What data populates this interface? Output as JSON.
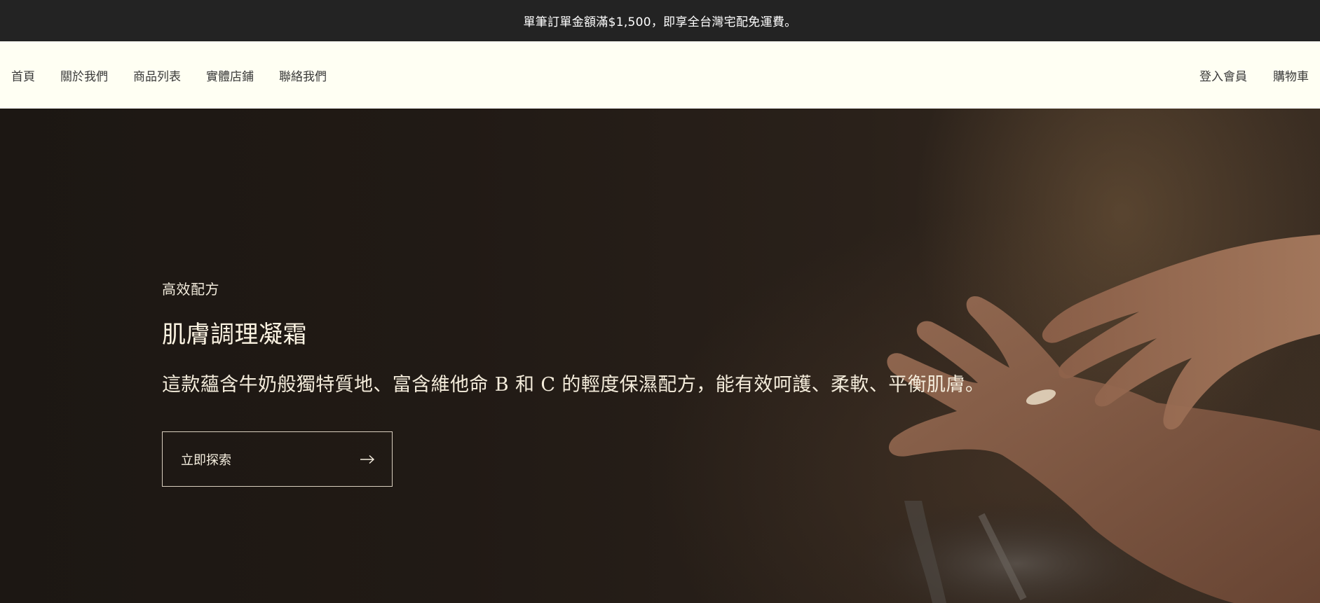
{
  "announcement": {
    "text": "單筆訂單金額滿$1,500，即享全台灣宅配免運費。"
  },
  "nav": {
    "left": [
      {
        "label": "首頁"
      },
      {
        "label": "關於我們"
      },
      {
        "label": "商品列表"
      },
      {
        "label": "實體店鋪"
      },
      {
        "label": "聯絡我們"
      }
    ],
    "right": [
      {
        "label": "登入會員"
      },
      {
        "label": "購物車"
      }
    ]
  },
  "hero": {
    "eyebrow": "高效配方",
    "title": "肌膚調理凝霜",
    "description": "這款蘊含牛奶般獨特質地、富含維他命 B 和 C 的輕度保濕配方，能有效呵護、柔軟、平衡肌膚。",
    "cta_label": "立即探索",
    "cta_icon": "arrow-right-icon"
  },
  "colors": {
    "announcement_bg": "#232323",
    "header_bg": "#fffff3",
    "hero_text": "#f4ecdb"
  }
}
